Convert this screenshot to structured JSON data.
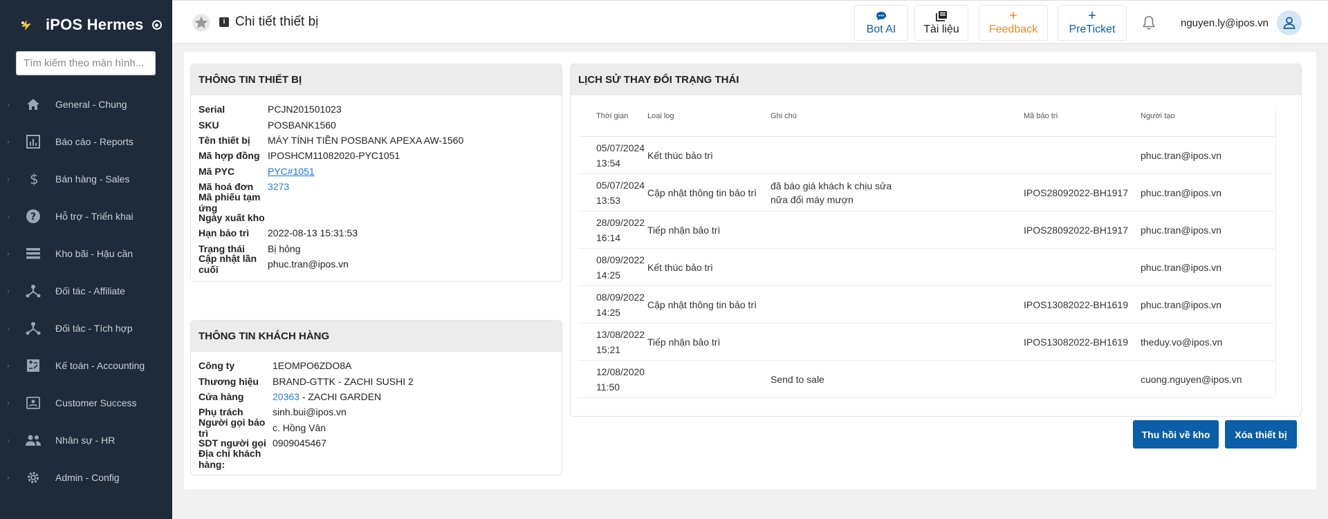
{
  "app": {
    "name": "iPOS Hermes"
  },
  "search": {
    "placeholder": "Tìm kiếm theo màn hình..."
  },
  "sidebar": {
    "items": [
      {
        "label": "General - Chung",
        "icon": "home-icon"
      },
      {
        "label": "Báo cáo - Reports",
        "icon": "bar-chart-icon"
      },
      {
        "label": "Bán hàng - Sales",
        "icon": "dollar-icon"
      },
      {
        "label": "Hỗ trợ - Triển khai",
        "icon": "help-icon"
      },
      {
        "label": "Kho bãi - Hậu cần",
        "icon": "list-icon"
      },
      {
        "label": "Đối tác - Affiliate",
        "icon": "network-icon"
      },
      {
        "label": "Đối tác - Tích hợp",
        "icon": "network-icon"
      },
      {
        "label": "Kế toán - Accounting",
        "icon": "accounting-icon"
      },
      {
        "label": "Customer Success",
        "icon": "contact-card-icon"
      },
      {
        "label": "Nhân sự - HR",
        "icon": "people-icon"
      },
      {
        "label": "Admin - Config",
        "icon": "gear-icon"
      }
    ]
  },
  "header": {
    "title": "Chi tiết thiết bị",
    "buttons": {
      "bot": "Bot AI",
      "docs": "Tài liệu",
      "feedback": "Feedback",
      "preticket": "PreTicket",
      "plus": "+"
    },
    "user_email": "nguyen.ly@ipos.vn"
  },
  "device": {
    "heading": "THÔNG TIN THIẾT BỊ",
    "fields": [
      {
        "label": "Serial",
        "value": "PCJN201501023"
      },
      {
        "label": "SKU",
        "value": "POSBANK1560"
      },
      {
        "label": "Tên thiết bị",
        "value": "MÁY TÍNH TIỀN POSBANK APEXA AW-1560"
      },
      {
        "label": "Mã hợp đồng",
        "value": "IPOSHCM11082020-PYC1051"
      },
      {
        "label": "Mã PYC",
        "value": "PYC#1051"
      },
      {
        "label": "Mã hoá đơn",
        "value": "3273"
      },
      {
        "label": "Mã phiếu tạm ứng",
        "value": ""
      },
      {
        "label": "Ngày xuất kho",
        "value": ""
      },
      {
        "label": "Hạn bảo trì",
        "value": "2022-08-13 15:31:53"
      },
      {
        "label": "Trạng thái",
        "value": "Bị hỏng"
      },
      {
        "label": "Cập nhật lần cuối",
        "value": "phuc.tran@ipos.vn"
      }
    ]
  },
  "customer": {
    "heading": "THÔNG TIN KHÁCH HÀNG",
    "fields": [
      {
        "label": "Công ty",
        "value": "1EOMPO6ZDO8A"
      },
      {
        "label": "Thương hiệu",
        "value": "BRAND-GTTK - ZACHI SUSHI 2"
      },
      {
        "label": "Cửa hàng",
        "value": "20363",
        "value_suffix": " - ZACHI GARDEN"
      },
      {
        "label": "Phụ trách",
        "value": "sinh.bui@ipos.vn"
      },
      {
        "label": "Người gọi bảo trì",
        "value": "c. Hồng Vân"
      },
      {
        "label": "SDT người gọi",
        "value": "0909045467"
      },
      {
        "label": "Địa chỉ khách hàng:",
        "value": ""
      }
    ]
  },
  "history": {
    "heading": "LỊCH SỬ THAY ĐỔI TRẠNG THÁI",
    "columns": [
      "Thời gian",
      "Loại log",
      "Ghi chú",
      "Mã bảo trì",
      "Người tạo"
    ],
    "rows": [
      {
        "date": "05/07/2024",
        "time": "13:54",
        "type": "Kết thúc bảo trì",
        "note": "",
        "code": "",
        "user": "phuc.tran@ipos.vn"
      },
      {
        "date": "05/07/2024",
        "time": "13:53",
        "type": "Cập nhật thông tin bảo trì",
        "note": "đã báo giá khách k chịu sửa nữa đổi máy mượn",
        "code": "IPOS28092022-BH1917",
        "user": "phuc.tran@ipos.vn"
      },
      {
        "date": "28/09/2022",
        "time": "16:14",
        "type": "Tiếp nhận bảo trì",
        "note": "",
        "code": "IPOS28092022-BH1917",
        "user": "phuc.tran@ipos.vn"
      },
      {
        "date": "08/09/2022",
        "time": "14:25",
        "type": "Kết thúc bảo trì",
        "note": "",
        "code": "",
        "user": "phuc.tran@ipos.vn"
      },
      {
        "date": "08/09/2022",
        "time": "14:25",
        "type": "Cập nhật thông tin bảo trì",
        "note": "",
        "code": "IPOS13082022-BH1619",
        "user": "phuc.tran@ipos.vn"
      },
      {
        "date": "13/08/2022",
        "time": "15:21",
        "type": "Tiếp nhận bảo trì",
        "note": "",
        "code": "IPOS13082022-BH1619",
        "user": "theduy.vo@ipos.vn"
      },
      {
        "date": "12/08/2020",
        "time": "11:50",
        "type": "",
        "note": "Send to sale",
        "code": "",
        "user": "cuong.nguyen@ipos.vn"
      }
    ]
  },
  "actions": {
    "recall": "Thu hồi về kho",
    "delete": "Xóa thiết bị"
  },
  "colors": {
    "sidebar": "#1f2a3a",
    "primary": "#0b5ea8",
    "feedback": "#f08a24",
    "link": "#1a73e8"
  }
}
